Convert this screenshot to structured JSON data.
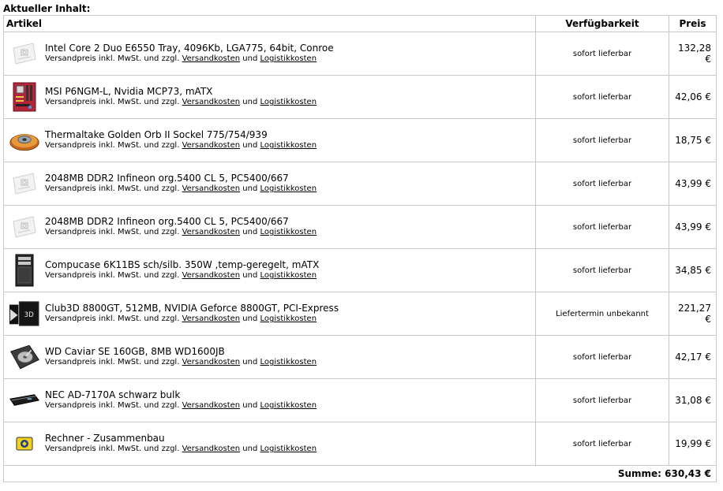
{
  "heading": "Aktueller Inhalt:",
  "columns": {
    "article": "Artikel",
    "availability": "Verfügbarkeit",
    "price": "Preis"
  },
  "shipping": {
    "prefix": "Versandpreis inkl. MwSt. und zzgl.",
    "link1": "Versandkosten",
    "joiner": "und",
    "link2": "Logistikkosten"
  },
  "items": [
    {
      "name": "Intel Core 2 Duo E6550 Tray, 4096Kb, LGA775, 64bit, Conroe",
      "availability": "sofort lieferbar",
      "price": "132,28 €",
      "icon": "placeholder-image-icon"
    },
    {
      "name": "MSI P6NGM-L, Nvidia MCP73, mATX",
      "availability": "sofort lieferbar",
      "price": "42,06 €",
      "icon": "motherboard-icon"
    },
    {
      "name": "Thermaltake Golden Orb II Sockel 775/754/939",
      "availability": "sofort lieferbar",
      "price": "18,75 €",
      "icon": "cpu-cooler-icon"
    },
    {
      "name": "2048MB DDR2 Infineon org.5400 CL 5, PC5400/667",
      "availability": "sofort lieferbar",
      "price": "43,99 €",
      "icon": "placeholder-image-icon"
    },
    {
      "name": "2048MB DDR2 Infineon org.5400 CL 5, PC5400/667",
      "availability": "sofort lieferbar",
      "price": "43,99 €",
      "icon": "placeholder-image-icon"
    },
    {
      "name": "Compucase 6K11BS sch/silb. 350W ,temp-geregelt, mATX",
      "availability": "sofort lieferbar",
      "price": "34,85 €",
      "icon": "pc-case-icon"
    },
    {
      "name": "Club3D 8800GT, 512MB, NVIDIA Geforce 8800GT, PCI-Express",
      "availability": "Liefertermin unbekannt",
      "price": "221,27 €",
      "icon": "graphics-card-icon"
    },
    {
      "name": "WD Caviar SE 160GB, 8MB WD1600JB",
      "availability": "sofort lieferbar",
      "price": "42,17 €",
      "icon": "hard-drive-icon"
    },
    {
      "name": "NEC AD-7170A schwarz bulk",
      "availability": "sofort lieferbar",
      "price": "31,08 €",
      "icon": "optical-drive-icon"
    },
    {
      "name": "Rechner - Zusammenbau",
      "availability": "sofort lieferbar",
      "price": "19,99 €",
      "icon": "assembly-service-icon"
    }
  ],
  "total": {
    "label": "Summe:",
    "value": "630,43 €"
  }
}
